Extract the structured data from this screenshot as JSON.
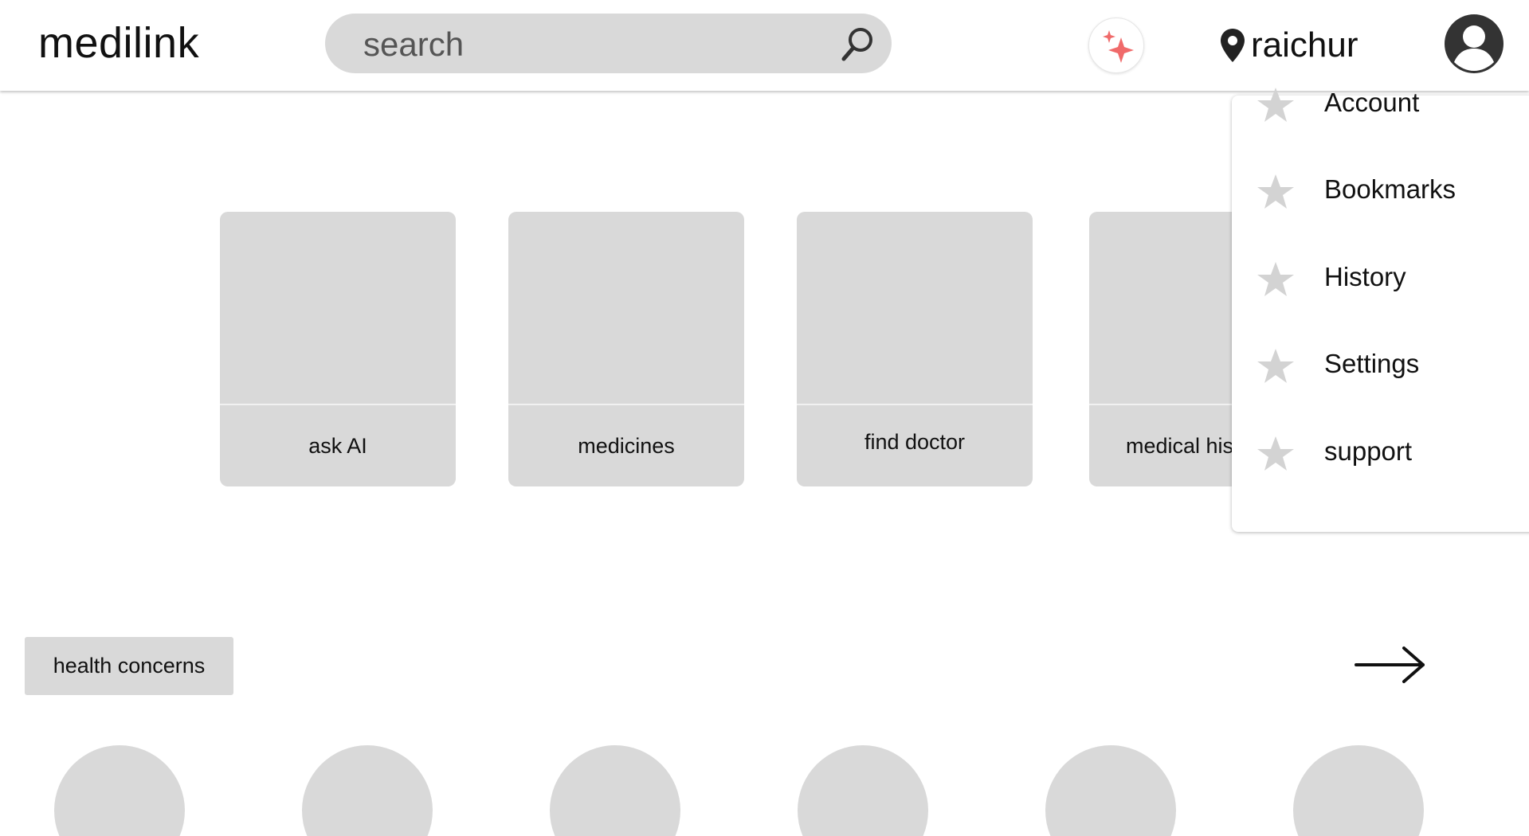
{
  "header": {
    "logo": "medilink",
    "search": {
      "placeholder": "search"
    },
    "location": "raichur"
  },
  "tiles": [
    {
      "label": "ask AI"
    },
    {
      "label": "medicines"
    },
    {
      "label": "find doctor"
    },
    {
      "label": "medical history"
    }
  ],
  "dropdown": {
    "items": [
      {
        "label": "Account",
        "icon": "star-icon"
      },
      {
        "label": "Bookmarks",
        "icon": "star-icon"
      },
      {
        "label": "History",
        "icon": "star-icon"
      },
      {
        "label": "Settings",
        "icon": "star-icon"
      },
      {
        "label": "support",
        "icon": "star-icon"
      }
    ]
  },
  "health_concerns": {
    "label": "health concerns",
    "items_count_visible": 6
  },
  "colors": {
    "placeholder_gray": "#d9d9d9",
    "sparkle": "#f06a6a",
    "icon_dark": "#333333",
    "star_gray": "#d3d3d3"
  }
}
